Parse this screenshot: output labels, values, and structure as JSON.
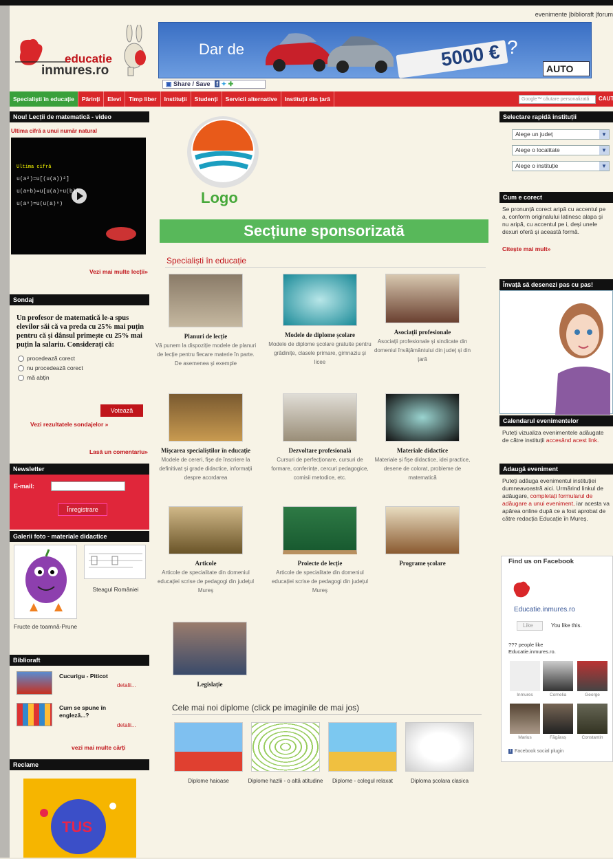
{
  "header": {
    "top_links": "evenimente |biblioraft |forum",
    "logo_line1": "educatie",
    "logo_line2": "inmures.ro",
    "banner_text": "Dar de",
    "banner_price": "5000 €",
    "banner_q": "?",
    "banner_brand": "AUTO",
    "share_label": "Share / Save"
  },
  "nav": {
    "items": [
      "Specialiști în educație",
      "Părinți",
      "Elevi",
      "Timp liber",
      "Instituții",
      "Studenți",
      "Servicii alternative",
      "Instituții din țară"
    ],
    "search_placeholder": "Google™ căutare personalizată",
    "search_button": "CAUTA"
  },
  "left": {
    "video_header": "Nou! Lecții de matematică - video",
    "video_title": "Ultima cifră a unui număr natural",
    "video_more": "Vezi mai multe lecții»",
    "poll_header": "Sondaj",
    "poll_question": "Un profesor de matematică le-a spus elevilor săi că va preda cu 25% mai puțin pentru că și dânsul primește cu 25% mai puțin la salariu. Considerați că:",
    "poll_options": [
      "procedează corect",
      "nu procedează corect",
      "mă abțin"
    ],
    "poll_vote": "Votează",
    "poll_results": "Vezi rezultatele sondajelor »",
    "poll_comment": "Lasă un comentariu»",
    "newsletter_header": "Newsletter",
    "newsletter_email": "E-mail:",
    "newsletter_button": "Înregistrare",
    "gallery_header": "Galerii foto - materiale didactice",
    "gallery_items": [
      "Fructe de toamnă-Prune",
      "Steagul României"
    ],
    "biblio_header": "Biblioraft",
    "biblio_items": [
      "Cucurigu - Piticot",
      "Cum se spune în engleză...?"
    ],
    "biblio_detail": "detalii...",
    "biblio_more": "vezi mai multe cărți",
    "ads_header": "Reclame"
  },
  "center": {
    "logo_label": "Logo",
    "sponsor": "Secțiune sponsorizată",
    "section_title": "Specialiști în educație",
    "tiles": [
      {
        "title": "Planuri de lecție",
        "desc": "Vă punem la dispoziție modele de planuri de lecție pentru fiecare materie în parte. De asemenea și exemple"
      },
      {
        "title": "Modele de diplome școlare",
        "desc": "Modele de diplome școlare gratuite pentru grădinițe, clasele primare, gimnaziu și licee"
      },
      {
        "title": "Asociații profesionale",
        "desc": "Asociații profesionale și sindicate din domeniul învățământului din județ și din țară"
      },
      {
        "title": "Mișcarea specialiștilor în educație",
        "desc": "Modele de cereri, fișe de înscriere la definitivat și grade didactice, informații despre acordarea"
      },
      {
        "title": "Dezvoltare profesională",
        "desc": "Cursuri de perfecționare, cursuri de formare, conferințe, cercuri pedagogice, comisii metodice, etc."
      },
      {
        "title": "Materiale didactice",
        "desc": "Materiale și fișe didactice, idei practice, desene de colorat, probleme de matematică"
      },
      {
        "title": "Articole",
        "desc": "Articole de specialitate din domeniul educației scrise de pedagogi din județul Mureș"
      },
      {
        "title": "Proiecte de lecție",
        "desc": "Articole de specialitate din domeniul educației scrise de pedagogi din județul Mureș"
      },
      {
        "title": "Programe școlare",
        "desc": ""
      },
      {
        "title": "Legislație",
        "desc": ""
      }
    ],
    "diplomas_title": "Cele mai noi diplome (click pe imaginile de mai jos)",
    "diplomas": [
      "Diplome haioase",
      "Diplome hazlii - o altă atitudine",
      "Diplome - colegul relaxat",
      "Diploma școlara clasica"
    ]
  },
  "right": {
    "quick_header": "Selectare rapidă instituții",
    "selects": [
      "Alege un județ",
      "Alege o localitate",
      "Alege o instituție"
    ],
    "correct_header": "Cum e corect",
    "correct_text": "Se pronunță corect aripă cu accentul pe a, conform originalului latinesc alapa și nu aripă, cu accentul pe i, deși unele dexuri oferă și această formă.",
    "correct_more": "Citește mai mult»",
    "draw_header": "Învață să desenezi pas cu pas!",
    "calendar_header": "Calendarul evenimentelor",
    "calendar_text": "Puteți vizualiza evenimentele adăugate de către instituții",
    "calendar_link": "accesând acest link.",
    "add_header": "Adaugă eveniment",
    "add_text1": "Puteți adăuga evenimentul instituției dumneavoastră aici. Urmărind linkul de adăugare,",
    "add_link": "completați formularul de adăugare a unui eveniment,",
    "add_text2": "iar acesta va apărea online după ce a fost aprobat de către redacția Educație în Mureș.",
    "fb_header": "Find us on Facebook",
    "fb_page": "Educatie.inmures.ro",
    "fb_like": "Like",
    "fb_like_text": "You like this.",
    "fb_count": "??? people like Educatie.inmures.ro.",
    "fb_people": [
      "Inmures",
      "Cornelia",
      "George",
      "Marius",
      "Făgăraș",
      "Constantin"
    ],
    "fb_plugin": "Facebook social plugin"
  },
  "colors": {
    "red": "#d9272a",
    "green": "#39a03b",
    "dark": "#111111"
  }
}
